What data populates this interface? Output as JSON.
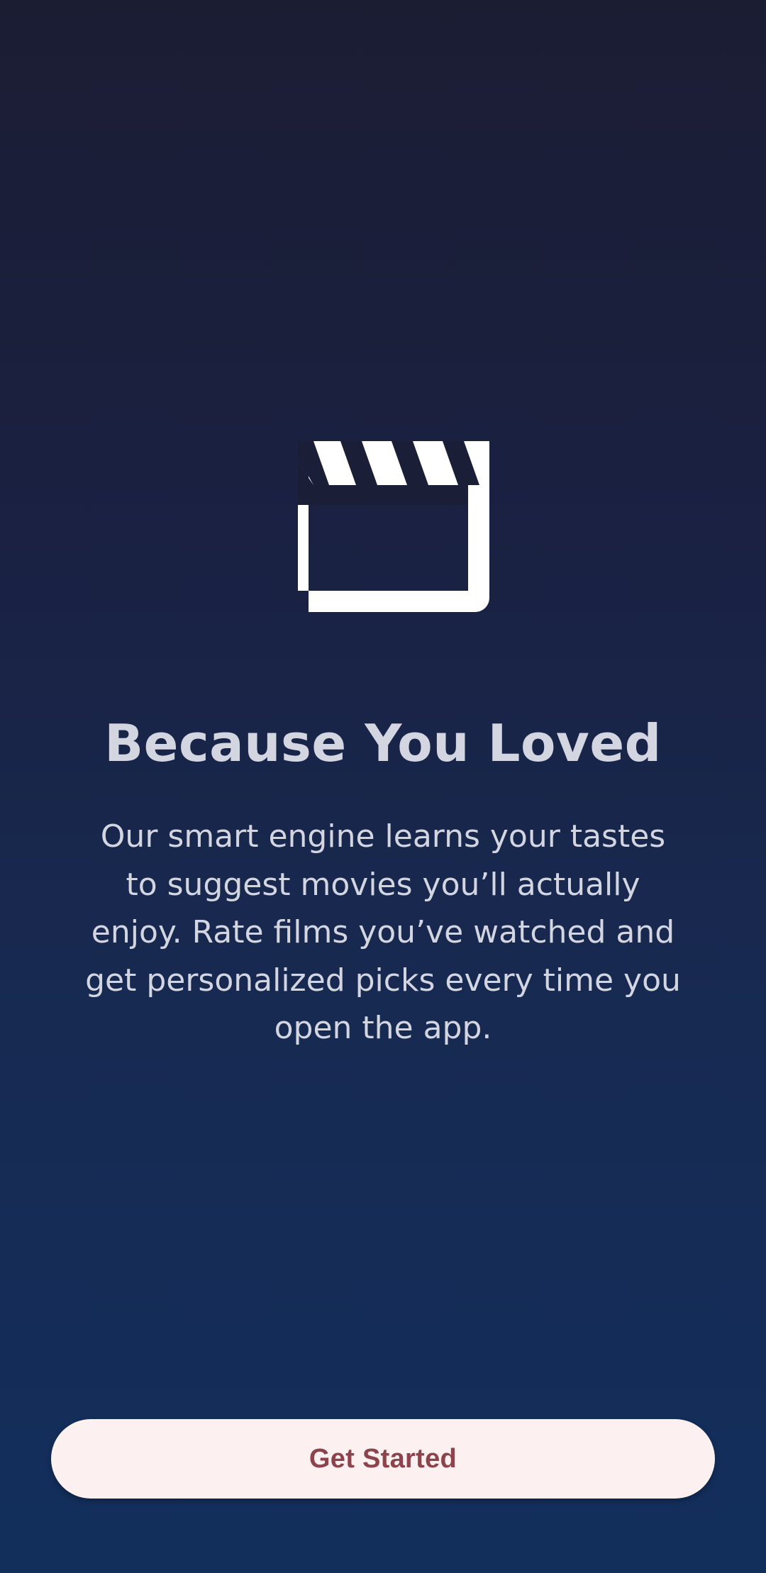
{
  "onboarding": {
    "icon": "clapperboard-icon",
    "title": "Because You Loved",
    "description": "Our smart engine learns your tastes to suggest movies you’ll actually enjoy. Rate films you’ve watched and get personalized picks every time you open the app.",
    "cta_label": "Get Started"
  },
  "colors": {
    "background_top": "#1b1d33",
    "background_bottom": "#122f5c",
    "text": "#d3d5e1",
    "button_background": "#fcf0f0",
    "button_text": "#8c434b",
    "icon": "#ffffff"
  }
}
